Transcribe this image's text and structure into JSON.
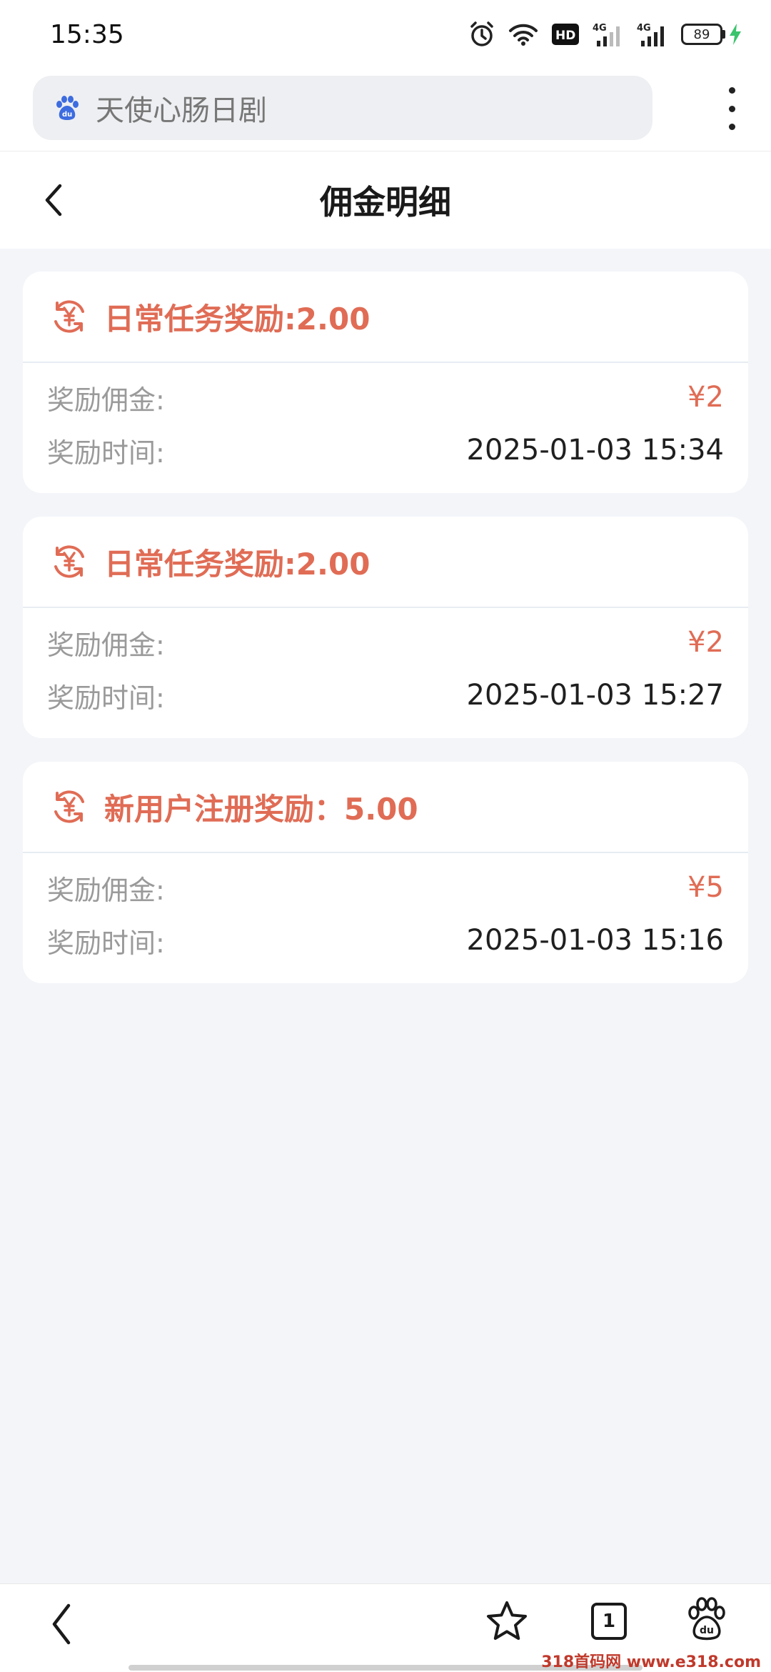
{
  "status_bar": {
    "time": "15:35",
    "network_1": "4G",
    "network_2": "4G",
    "hd_badge": "HD",
    "battery": "89"
  },
  "browser": {
    "search_text": "天使心肠日剧",
    "logo_icon": "baidu-paw-icon"
  },
  "header": {
    "title": "佣金明细"
  },
  "labels": {
    "commission": "奖励佣金:",
    "time": "奖励时间:"
  },
  "records": [
    {
      "title": "日常任务奖励:2.00",
      "amount": "¥2",
      "time": "2025-01-03 15:34"
    },
    {
      "title": "日常任务奖励:2.00",
      "amount": "¥2",
      "time": "2025-01-03 15:27"
    },
    {
      "title": "新用户注册奖励：5.00",
      "amount": "¥5",
      "time": "2025-01-03 15:16"
    }
  ],
  "bottom_nav": {
    "tab_count": "1"
  },
  "watermark": "318首码网 www.e318.com",
  "colors": {
    "accent": "#e06c55",
    "background": "#f3f5f9",
    "baidu_blue": "#3d6ce0"
  }
}
